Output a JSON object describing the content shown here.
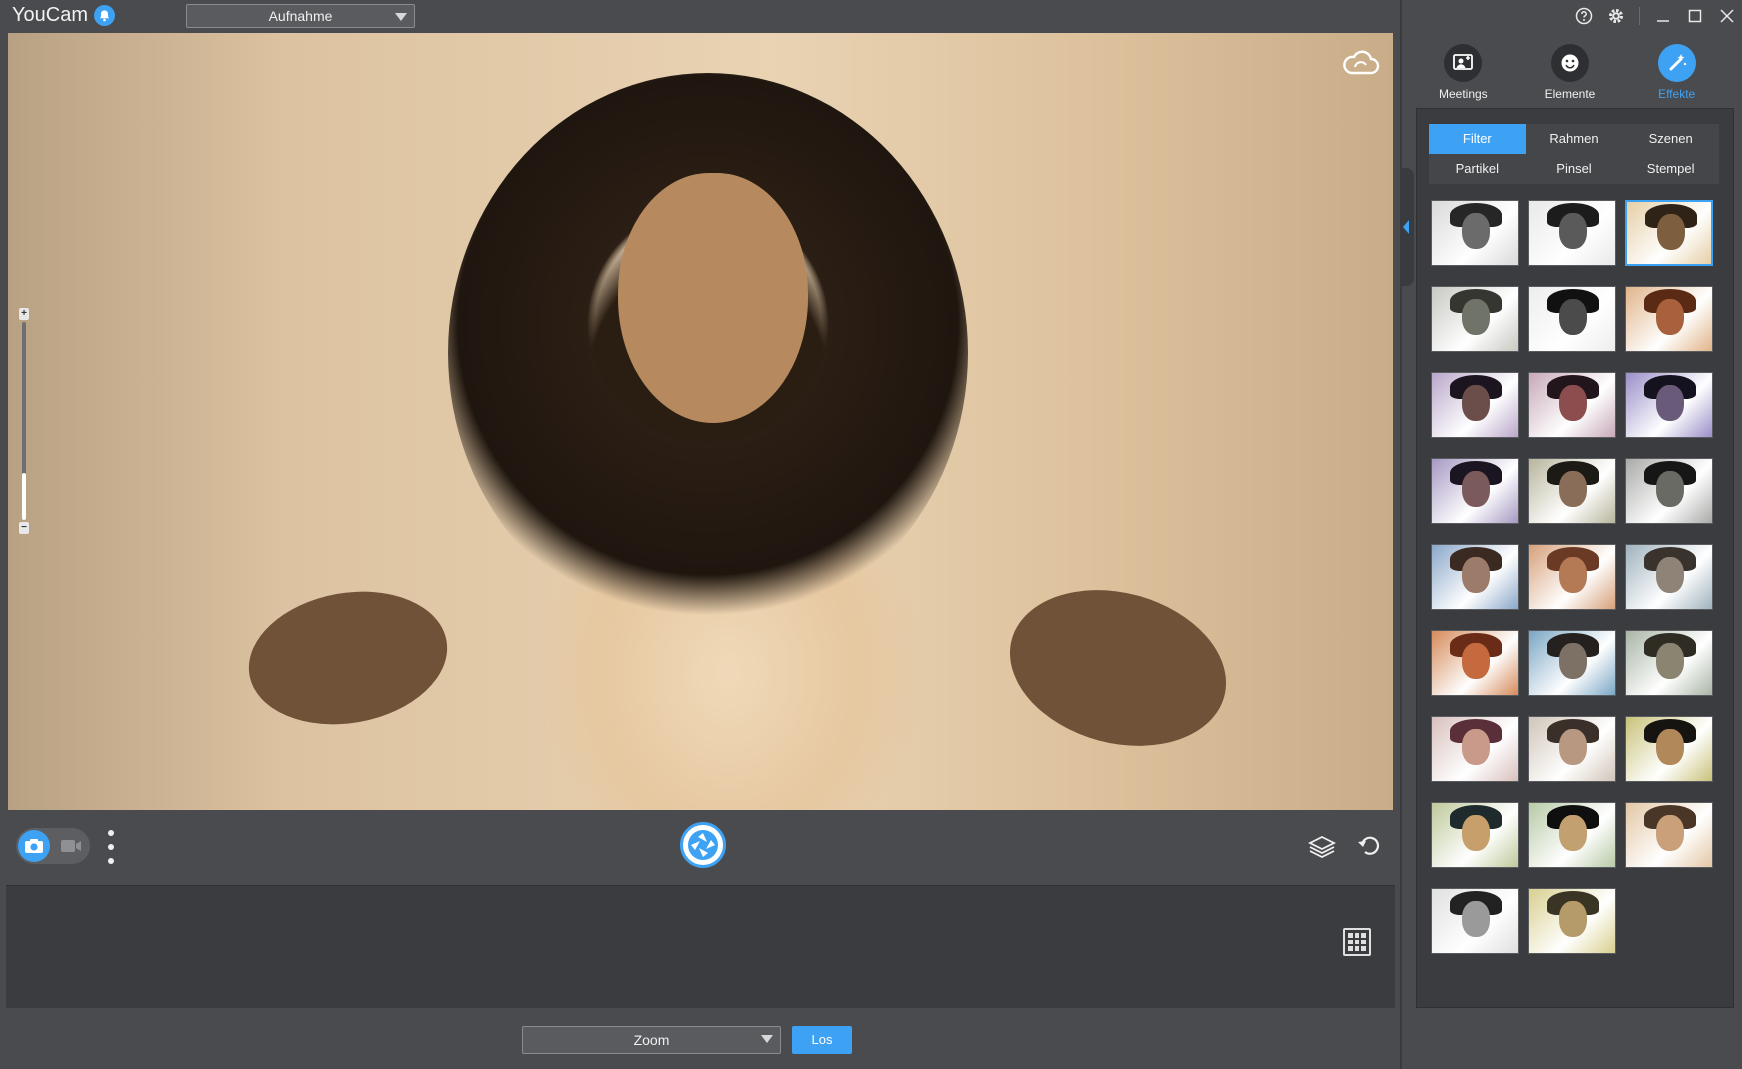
{
  "app": {
    "title": "YouCam"
  },
  "source": {
    "selected": "Aufnahme"
  },
  "bottom": {
    "app_selected": "Zoom",
    "go_label": "Los"
  },
  "right_panel": {
    "main_tabs": [
      {
        "label": "Meetings",
        "icon": "meetings-icon",
        "active": false
      },
      {
        "label": "Elemente",
        "icon": "smiley-icon",
        "active": false
      },
      {
        "label": "Effekte",
        "icon": "magic-wand-icon",
        "active": true
      }
    ],
    "sub_tabs": [
      {
        "label": "Filter",
        "active": true
      },
      {
        "label": "Rahmen",
        "active": false
      },
      {
        "label": "Szenen",
        "active": false
      },
      {
        "label": "Partikel",
        "active": false
      },
      {
        "label": "Pinsel",
        "active": false
      },
      {
        "label": "Stempel",
        "active": false
      }
    ],
    "filters": [
      {
        "bg": "#d9d9d9",
        "skin": "#6b6b6b",
        "hair": "#262626",
        "selected": false
      },
      {
        "bg": "#e9e9e9",
        "skin": "#5a5a5a",
        "hair": "#1c1c1c",
        "selected": false
      },
      {
        "bg": "#e6cfa6",
        "skin": "#7d5f3f",
        "hair": "#2f2318",
        "selected": true
      },
      {
        "bg": "#c7c9c2",
        "skin": "#707368",
        "hair": "#34362f",
        "selected": false
      },
      {
        "bg": "#ededed",
        "skin": "#4b4b4b",
        "hair": "#111111",
        "selected": false
      },
      {
        "bg": "#e1b48a",
        "skin": "#a8613c",
        "hair": "#5b2a14",
        "selected": false
      },
      {
        "bg": "#b9a6c9",
        "skin": "#6b4d4a",
        "hair": "#1c1520",
        "selected": false
      },
      {
        "bg": "#c7a8b8",
        "skin": "#8c4d4f",
        "hair": "#22151b",
        "selected": false
      },
      {
        "bg": "#9a8fc8",
        "skin": "#6a5a7a",
        "hair": "#15121f",
        "selected": false
      },
      {
        "bg": "#a698c2",
        "skin": "#7a5a5a",
        "hair": "#1a1520",
        "selected": false
      },
      {
        "bg": "#b8b59c",
        "skin": "#8a6d58",
        "hair": "#1c1a14",
        "selected": false
      },
      {
        "bg": "#a9aaa8",
        "skin": "#6a6a64",
        "hair": "#161616",
        "selected": false
      },
      {
        "bg": "#8aa7c9",
        "skin": "#9c7b6b",
        "hair": "#3b2a22",
        "selected": false
      },
      {
        "bg": "#d6a07a",
        "skin": "#b47a55",
        "hair": "#6a3a24",
        "selected": false
      },
      {
        "bg": "#9fb2bd",
        "skin": "#8f8378",
        "hair": "#3a322c",
        "selected": false
      },
      {
        "bg": "#d58a5a",
        "skin": "#c46a3e",
        "hair": "#6a2c16",
        "selected": false
      },
      {
        "bg": "#7aa6c4",
        "skin": "#7d7065",
        "hair": "#24211f",
        "selected": false
      },
      {
        "bg": "#a9b5a6",
        "skin": "#8a8470",
        "hair": "#2f2c24",
        "selected": false
      },
      {
        "bg": "#d8c0bd",
        "skin": "#c99a8a",
        "hair": "#5a2f3a",
        "selected": false
      },
      {
        "bg": "#d0c5b8",
        "skin": "#b89880",
        "hair": "#3a3029",
        "selected": false
      },
      {
        "bg": "#c9c27a",
        "skin": "#b0885a",
        "hair": "#161410",
        "selected": false
      },
      {
        "bg": "#bdc99a",
        "skin": "#c79f6a",
        "hair": "#1e2a2c",
        "selected": false
      },
      {
        "bg": "#b7caa6",
        "skin": "#c3a070",
        "hair": "#0f0f0f",
        "selected": false
      },
      {
        "bg": "#e3c7a5",
        "skin": "#c9a07a",
        "hair": "#4a3626",
        "selected": false
      },
      {
        "bg": "#e0e0e0",
        "skin": "#9a9a9a",
        "hair": "#222222",
        "selected": false
      },
      {
        "bg": "#d9cf8f",
        "skin": "#b59a6a",
        "hair": "#3a3424",
        "selected": false
      }
    ]
  },
  "colors": {
    "accent": "#3ea2f4",
    "panel": "#4a4b4e",
    "dark": "#3b3c3f"
  },
  "icons": {
    "notification": "bell-icon",
    "cloud": "cloud-sync-icon",
    "photo_mode": "camera-icon",
    "video_mode": "video-camera-icon",
    "more": "more-vertical-icon",
    "shutter": "shutter-icon",
    "layers": "layers-icon",
    "undo": "undo-icon",
    "gallery_grid": "grid-icon",
    "help": "help-icon",
    "settings": "gear-icon",
    "minimize": "minimize-icon",
    "maximize": "maximize-icon",
    "close": "close-icon"
  }
}
